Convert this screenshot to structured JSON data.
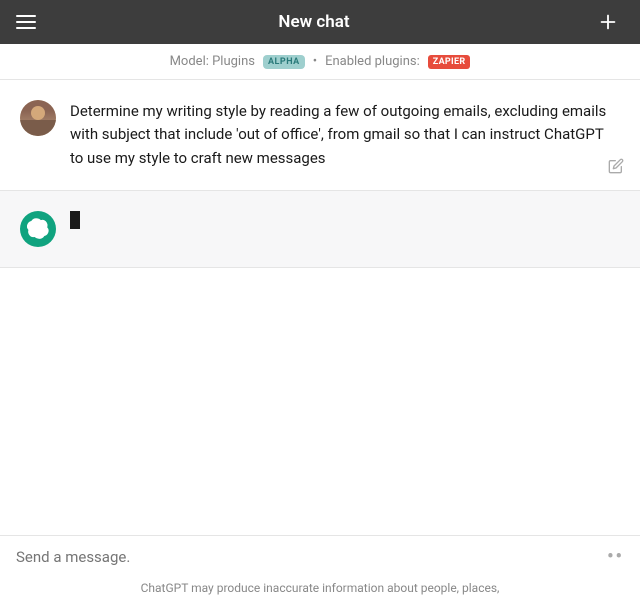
{
  "header": {
    "title": "New chat",
    "menu_icon": "hamburger",
    "add_icon": "plus"
  },
  "model_bar": {
    "model_label": "Model: Plugins",
    "alpha_badge": "ALPHA",
    "separator": "•",
    "enabled_label": "Enabled plugins:",
    "plugin_badge": "ZAPIER"
  },
  "user_message": {
    "text": "Determine my writing style by reading a few of outgoing emails, excluding emails with subject that include 'out of office', from gmail so that I can instruct ChatGPT to use my style to craft new messages"
  },
  "bot_message": {
    "loading": true
  },
  "input": {
    "placeholder": "Send a message.",
    "more_icon": "••"
  },
  "disclaimer": {
    "text": "ChatGPT may produce inaccurate information about people, places,"
  }
}
